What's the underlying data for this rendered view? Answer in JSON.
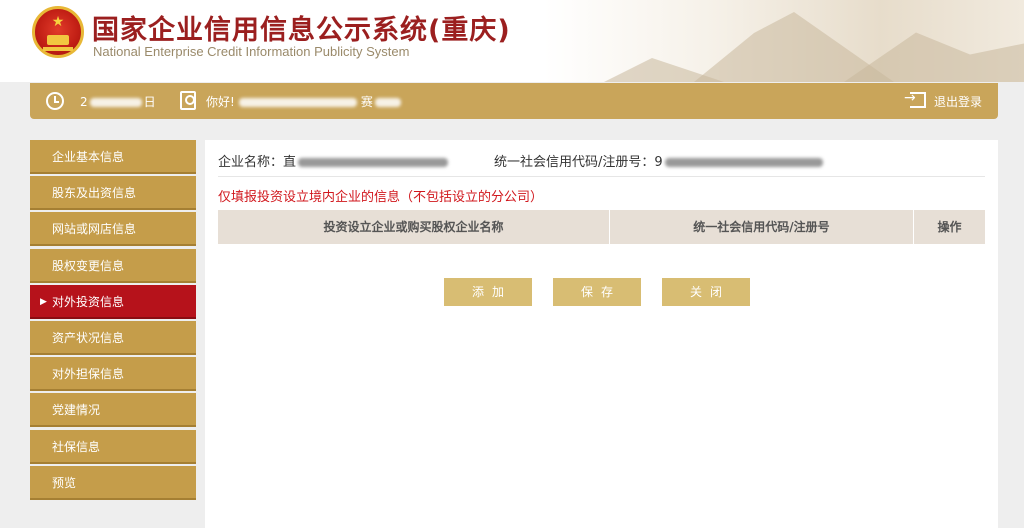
{
  "header": {
    "title_cn": "国家企业信用信息公示系统(重庆)",
    "title_en": "National Enterprise Credit Information Publicity System"
  },
  "infobar": {
    "date_prefix": "2",
    "date_suffix": "日",
    "greeting": "你好!",
    "greeting_suffix": "赛",
    "logout": "退出登录"
  },
  "sidebar": {
    "items": [
      {
        "label": "企业基本信息",
        "active": false
      },
      {
        "label": "股东及出资信息",
        "active": false
      },
      {
        "label": "网站或网店信息",
        "active": false
      },
      {
        "label": "股权变更信息",
        "active": false
      },
      {
        "label": "对外投资信息",
        "active": true
      },
      {
        "label": "资产状况信息",
        "active": false
      },
      {
        "label": "对外担保信息",
        "active": false
      },
      {
        "label": "党建情况",
        "active": false
      },
      {
        "label": "社保信息",
        "active": false
      },
      {
        "label": "预览",
        "active": false
      }
    ]
  },
  "main": {
    "company_label": "企业名称：",
    "company_value_visible": "直",
    "code_label": "统一社会信用代码/注册号：",
    "code_value_visible": "9",
    "notice": "仅填报投资设立境内企业的信息（不包括设立的分公司）",
    "table": {
      "columns": [
        "投资设立企业或购买股权企业名称",
        "统一社会信用代码/注册号",
        "操作"
      ],
      "rows": []
    },
    "buttons": {
      "add": "添加",
      "save": "保存",
      "close": "关闭"
    }
  },
  "colors": {
    "gold": "#c59d4a",
    "active_red": "#b6121b",
    "title_red": "#9b1f1f",
    "notice_red": "#d1171d",
    "button_gold": "#d8bd73"
  }
}
